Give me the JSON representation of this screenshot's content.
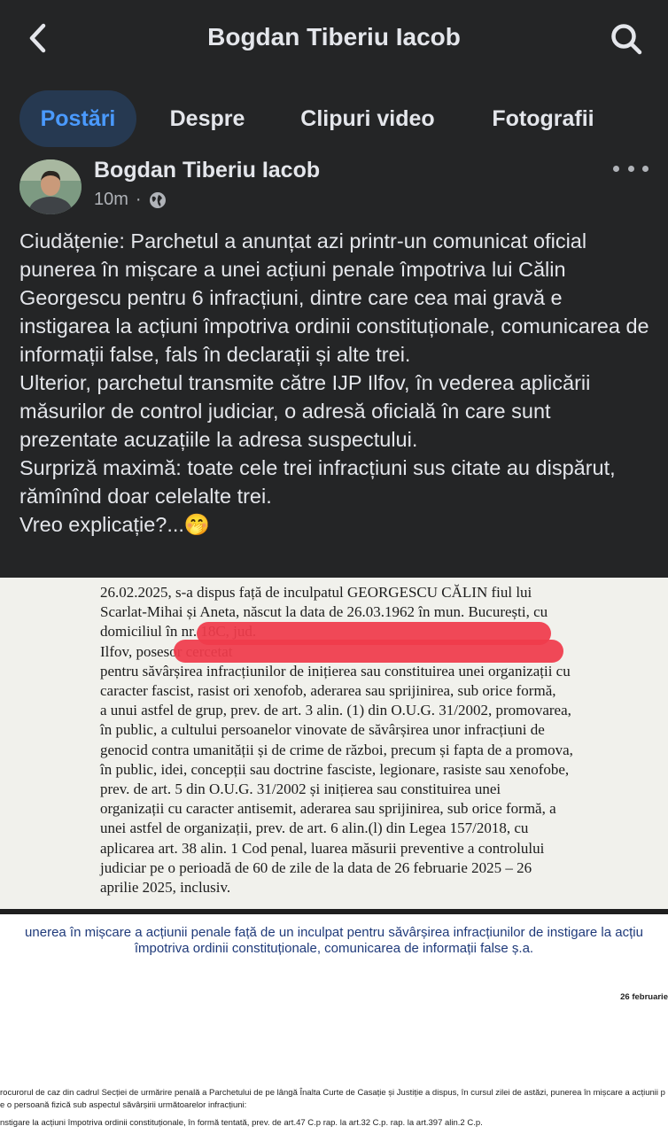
{
  "header": {
    "title": "Bogdan Tiberiu Iacob"
  },
  "tabs": [
    {
      "label": "Postări"
    },
    {
      "label": "Despre"
    },
    {
      "label": "Clipuri video"
    },
    {
      "label": "Fotografii"
    }
  ],
  "post": {
    "author": "Bogdan Tiberiu Iacob",
    "time": "10m",
    "separator": "·",
    "paragraphs": [
      "Ciudățenie: Parchetul a anunțat azi printr-un comunicat oficial punerea în mișcare a unei acțiuni penale împotriva lui Călin Georgescu pentru 6 infracțiuni, dintre care cea mai gravă e instigarea la acțiuni împotriva ordinii constituționale, comunicarea de informații false, fals în declarații și alte trei.",
      "Ulterior, parchetul transmite către IJP Ilfov, în vederea aplicării măsurilor de control judiciar, o adresă oficială în care sunt prezentate acuzațiile la adresa suspectului.",
      "Surpriză maximă: toate cele trei infracțiuni sus citate au dispărut, rămînînd doar celelalte trei.",
      "Vreo explicație?...🤭"
    ]
  },
  "document_top": {
    "lines": [
      "26.02.2025, s-a dispus față de inculpatul GEORGESCU CĂLIN fiul lui",
      "Scarlat-Mihai și Aneta, născut la data de 26.03.1962 în mun. București, cu",
      "domiciliul în                                                   nr. 18C, jud.",
      "Ilfov, posesor                                                              cercetat",
      "pentru săvârșirea infracțiunilor de inițierea sau constituirea unei organizații cu",
      "caracter fascist, rasist ori xenofob, aderarea sau sprijinirea, sub orice formă,",
      "a unui astfel de grup, prev. de art. 3 alin. (1) din O.U.G. 31/2002, promovarea,",
      "în public, a cultului persoanelor vinovate de săvârșirea unor infracțiuni de",
      "genocid contra umanității și de crime de război, precum și fapta de a promova,",
      "în public, idei, concepții sau doctrine fasciste, legionare, rasiste sau xenofobe,",
      "prev. de art. 5  din O.U.G. 31/2002 și inițierea sau constituirea unei",
      "organizații cu caracter antisemit, aderarea sau sprijinirea, sub orice formă, a",
      "unei astfel de organizații, prev. de art. 6 alin.(l) din Legea 157/2018, cu",
      "aplicarea art. 38 alin. 1 Cod penal, luarea măsurii preventive a controlului",
      "judiciar pe o perioadă de 60 de zile de la data de 26 februarie 2025 – 26",
      "aprilie 2025, inclusiv."
    ]
  },
  "document_bottom": {
    "heading_line1": "unerea în mișcare a acțiunii penale față de un inculpat pentru săvârșirea infracțiunilor de instigare la acțiu",
    "heading_line2": "împotriva ordinii constituționale, comunicarea de informații false ș.a.",
    "date": "26 februarie",
    "body_line1": "rocurorul de caz din cadrul Secției de urmărire penală a Parchetului de pe lângă Înalta Curte de Casație și Justiție a dispus, în cursul zilei de astăzi, punerea în mișcare a acțiunii p",
    "body_line2": "e o persoană fizică  sub aspectul săvârșirii următoarelor infracțiuni:",
    "body_line3": "nstigare la acțiuni împotriva ordinii constituționale, în formă tentată, prev. de art.47 C.p rap. la art.32 C.p. rap. la art.397 alin.2 C.p."
  },
  "colors": {
    "background": "#242526",
    "text": "#e4e6eb",
    "muted": "#b0b3b8",
    "active_tab_bg": "#263951",
    "active_tab_text": "#4a9aff",
    "redaction": "#f03b4b"
  },
  "icons": {
    "back": "chevron-left-icon",
    "search": "search-icon",
    "more": "more-horizontal-icon",
    "audience": "globe-icon"
  }
}
